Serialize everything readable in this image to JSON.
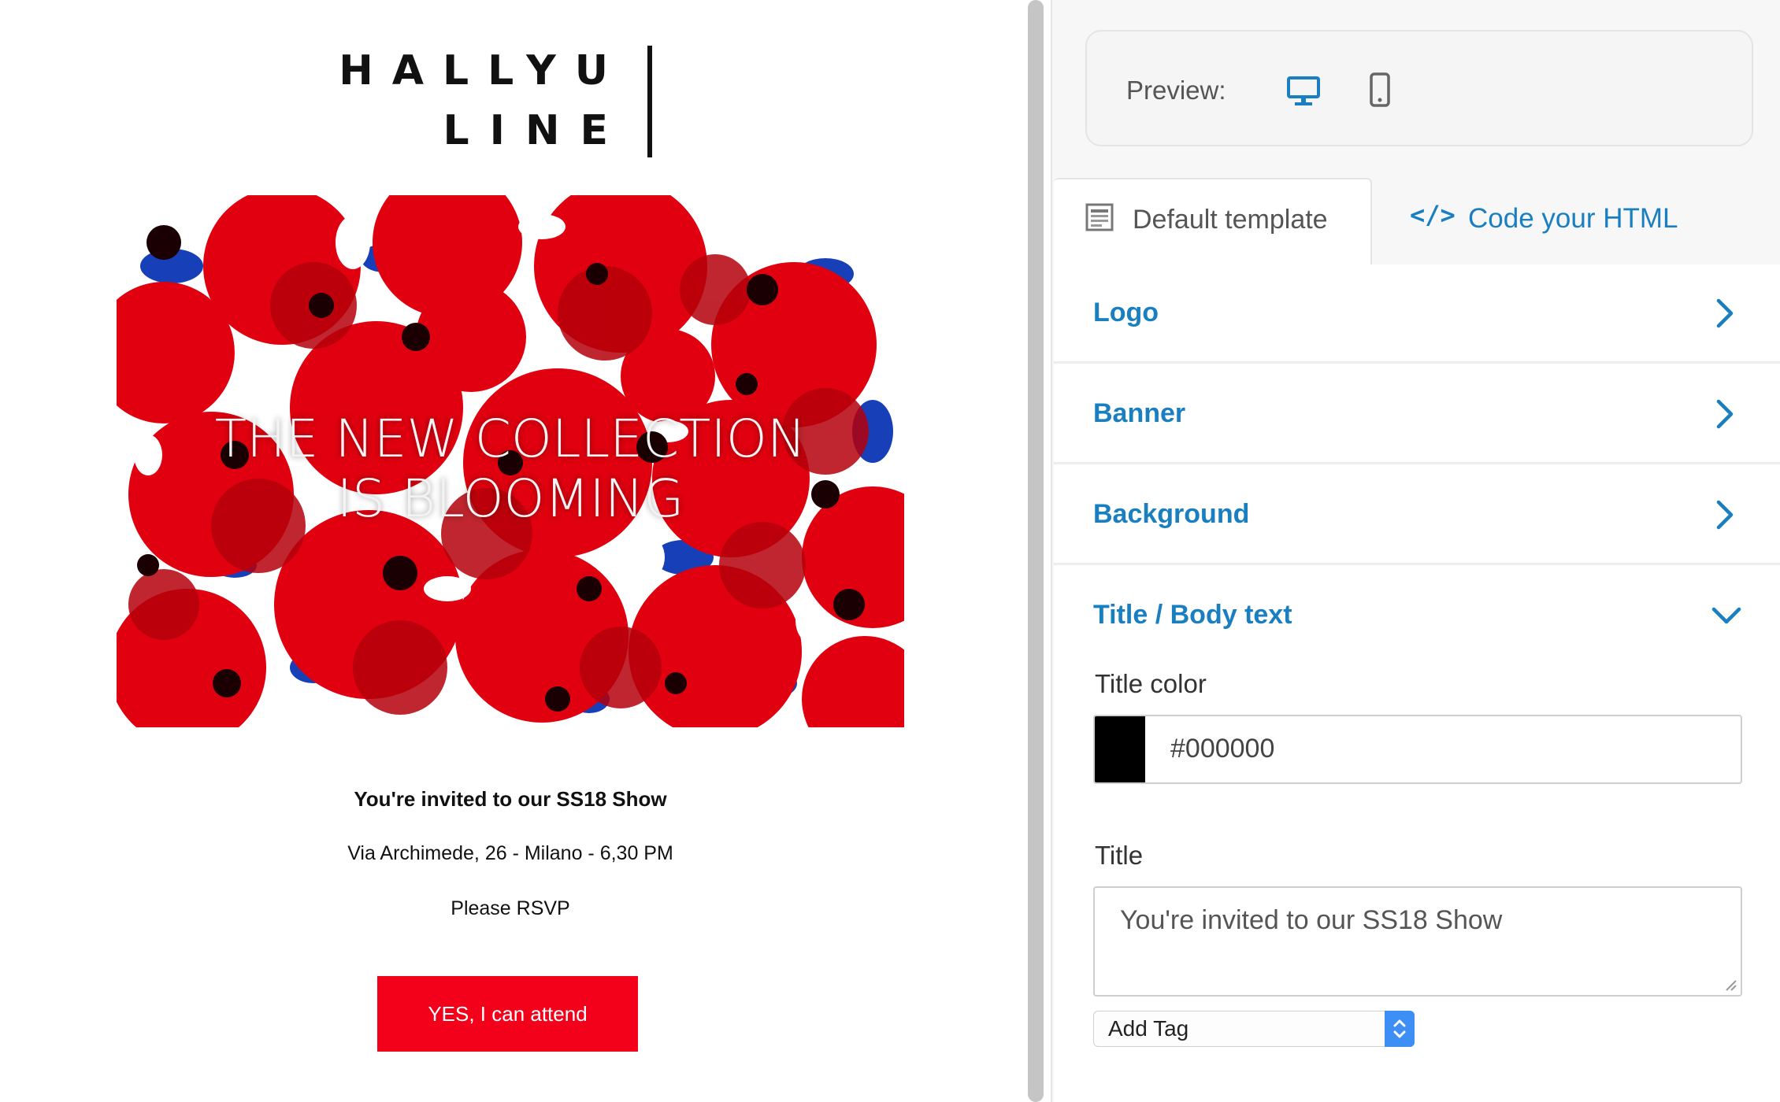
{
  "email": {
    "logo": {
      "line1": "HALLYU",
      "line2": "LINE"
    },
    "banner": {
      "headline_line1": "THE NEW COLLECTION",
      "headline_line2": "IS BLOOMING"
    },
    "title": "You're invited to our SS18 Show",
    "address": "Via Archimede, 26 - Milano - 6,30 PM",
    "rsvp_text": "Please RSVP",
    "button_label": "YES, I can attend",
    "button_color": "#f3001a"
  },
  "panel": {
    "preview": {
      "label": "Preview:",
      "desktop_icon": "desktop-icon",
      "mobile_icon": "mobile-icon"
    },
    "tabs": [
      {
        "label": "Default template",
        "icon": "template-icon",
        "active": true
      },
      {
        "label": "Code your HTML",
        "icon": "code-icon",
        "active": false
      }
    ],
    "sections": [
      {
        "label": "Logo",
        "expanded": false
      },
      {
        "label": "Banner",
        "expanded": false
      },
      {
        "label": "Background",
        "expanded": false
      },
      {
        "label": "Title / Body text",
        "expanded": true
      }
    ],
    "title_color": {
      "label": "Title color",
      "value": "#000000"
    },
    "title_field": {
      "label": "Title",
      "value": "You're invited to our SS18 Show"
    },
    "add_tag": {
      "label": "Add Tag"
    }
  },
  "colors": {
    "accent_blue": "#1a7fc1",
    "swatch": "#000000"
  }
}
